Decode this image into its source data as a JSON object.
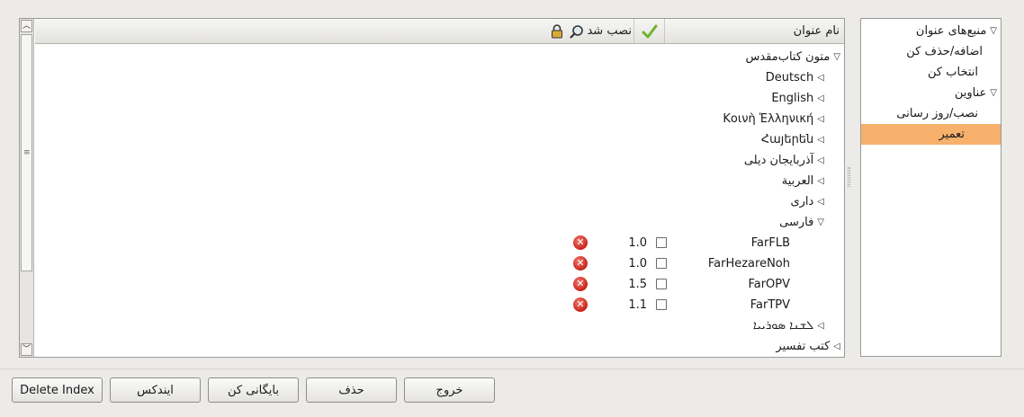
{
  "categories": {
    "items": [
      {
        "label": "منبع‌های عنوان",
        "expander": "▽"
      },
      {
        "label": "اضافه/حذف کن",
        "expander": ""
      },
      {
        "label": "انتخاب کن",
        "expander": ""
      },
      {
        "label": "عناوین",
        "expander": "▽"
      },
      {
        "label": "نصب/روز رسانی",
        "expander": ""
      },
      {
        "label": "تعمیر",
        "expander": "",
        "selected": true
      }
    ]
  },
  "tree": {
    "header": {
      "name": "نام عنوان",
      "installed": "نصب شد",
      "check_icon": "check-icon",
      "search_icon": "magnifier-icon",
      "lock_icon": "lock-icon"
    },
    "root": {
      "label": "متون کتاب‌مقدس",
      "expander": "▽"
    },
    "languages": [
      {
        "label": "Deutsch",
        "expander": "◁"
      },
      {
        "label": "English",
        "expander": "◁"
      },
      {
        "label": "Κοινὴ Ἑλληνική",
        "expander": "◁"
      },
      {
        "label": "Հայերեն",
        "expander": "◁"
      },
      {
        "label": "آذربایجان دیلی",
        "expander": "◁"
      },
      {
        "label": "العربية",
        "expander": "◁"
      },
      {
        "label": "داری",
        "expander": "◁"
      },
      {
        "label": "فارسی",
        "expander": "▽"
      }
    ],
    "modules": [
      {
        "name": "FarFLB",
        "version": "1.0",
        "installed": false
      },
      {
        "name": "FarHezareNoh",
        "version": "1.0",
        "installed": false
      },
      {
        "name": "FarOPV",
        "version": "1.5",
        "installed": false
      },
      {
        "name": "FarTPV",
        "version": "1.1",
        "installed": false
      }
    ],
    "after": [
      {
        "label": "ܠܫܢܐ ܣܘܪܝܝܐ",
        "expander": "◁"
      }
    ],
    "second_root": {
      "label": "کتب تفسیر",
      "expander": "◁"
    }
  },
  "buttons": {
    "delete_index": "Delete Index",
    "index": "ایندکس",
    "archive": "بایگانی کن",
    "delete": "حذف",
    "exit": "خروج"
  },
  "colors": {
    "selection": "#f7b16c",
    "delete_icon": "#c9231a",
    "check_icon": "#6fb52c"
  }
}
